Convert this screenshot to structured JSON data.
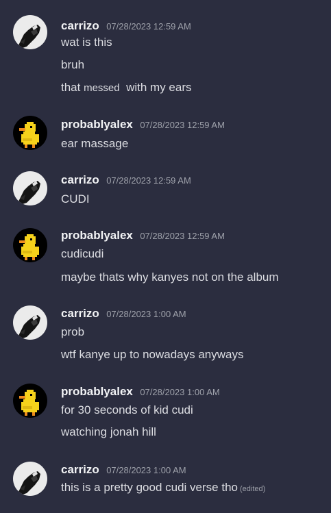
{
  "messages": [
    {
      "author": "carrizo",
      "timestamp": "07/28/2023 12:59 AM",
      "lines": [
        "wat is this",
        "bruh",
        "that",
        "messed",
        "with my ears"
      ]
    },
    {
      "author": "probablyalex",
      "timestamp": "07/28/2023 12:59 AM",
      "lines": [
        "ear massage"
      ]
    },
    {
      "author": "carrizo",
      "timestamp": "07/28/2023 12:59 AM",
      "lines": [
        "CUDI"
      ]
    },
    {
      "author": "probablyalex",
      "timestamp": "07/28/2023 12:59 AM",
      "lines": [
        "cudicudi",
        "maybe thats why kanyes not on the album"
      ]
    },
    {
      "author": "carrizo",
      "timestamp": "07/28/2023 1:00 AM",
      "lines": [
        "prob",
        "wtf kanye up to nowadays anyways"
      ]
    },
    {
      "author": "probablyalex",
      "timestamp": "07/28/2023 1:00 AM",
      "lines": [
        "for 30 seconds of kid cudi",
        "watching jonah hill"
      ]
    },
    {
      "author": "carrizo",
      "timestamp": "07/28/2023 1:00 AM",
      "lines": [
        "this is a pretty good cudi verse tho"
      ],
      "edited_label": "(edited)"
    }
  ],
  "colors": {
    "background": "#2b2d3f",
    "username": "#f2f3f5",
    "text": "#dcdde2",
    "muted": "#9fa2ab"
  },
  "icons": {
    "carrizo_avatar": "hooded-figure-avatar-icon",
    "probablyalex_avatar": "pixel-duck-avatar-icon"
  }
}
